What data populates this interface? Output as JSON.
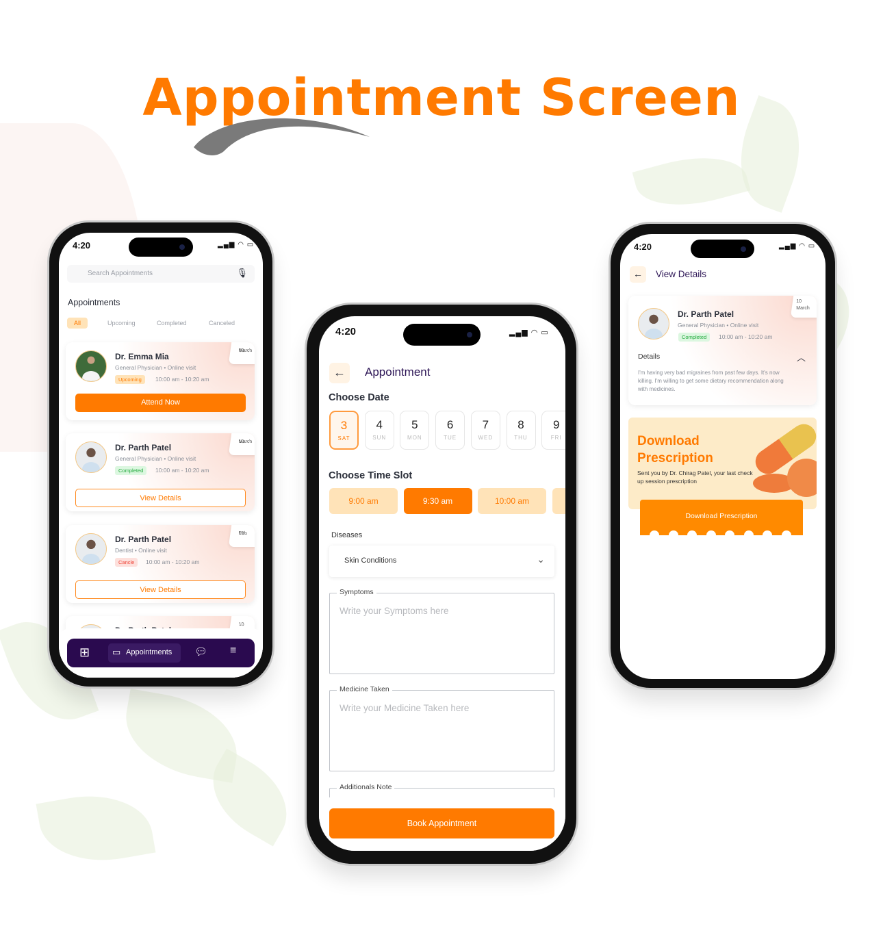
{
  "page_title": "Appointment Screen",
  "colors": {
    "accent": "#ff7a00",
    "nav_bg": "#2a0a4f",
    "title_purple": "#2d1656"
  },
  "status_time": "4:20",
  "list_screen": {
    "search_placeholder": "Search Appointments",
    "mic_icon": "microphone-icon",
    "heading": "Appointments",
    "tabs": [
      {
        "label": "All",
        "active": true
      },
      {
        "label": "Upcoming"
      },
      {
        "label": "Completed"
      },
      {
        "label": "Canceled"
      }
    ],
    "cards": [
      {
        "name": "Dr. Emma Mia",
        "specialty": "General Physician",
        "visit": "Online visit",
        "status": "Upcoming",
        "time": "10:00 am - 10:20 am",
        "day": "03",
        "month": "March",
        "button": "Attend Now",
        "primary": true
      },
      {
        "name": "Dr. Parth Patel",
        "specialty": "General Physician",
        "visit": "Online visit",
        "status": "Completed",
        "time": "10:00 am - 10:20 am",
        "day": "10",
        "month": "March",
        "button": "View Details"
      },
      {
        "name": "Dr. Parth Patel",
        "specialty": "Dentist",
        "visit": "Online visit",
        "status": "Cancle",
        "time": "10:00 am - 10:20 am",
        "day": "10",
        "month": "Feb",
        "button": "View Details"
      },
      {
        "name": "Dr. Parth Patel",
        "day": "10"
      }
    ],
    "nav": {
      "items": [
        {
          "icon": "grid-icon"
        },
        {
          "icon": "calendar-card-icon",
          "label": "Appointments",
          "active": true
        },
        {
          "icon": "chat-icon"
        },
        {
          "icon": "menu-icon"
        }
      ]
    }
  },
  "booking_screen": {
    "title": "Appointment",
    "choose_date": "Choose Date",
    "dates": [
      {
        "n": "3",
        "d": "SAT",
        "selected": true
      },
      {
        "n": "4",
        "d": "SUN"
      },
      {
        "n": "5",
        "d": "MON"
      },
      {
        "n": "6",
        "d": "TUE"
      },
      {
        "n": "7",
        "d": "WED"
      },
      {
        "n": "8",
        "d": "THU"
      },
      {
        "n": "9",
        "d": "FRI"
      }
    ],
    "choose_time": "Choose Time Slot",
    "slots": [
      {
        "t": "9:00 am"
      },
      {
        "t": "9:30 am",
        "selected": true
      },
      {
        "t": "10:00 am"
      },
      {
        "t": ""
      }
    ],
    "diseases_label": "Diseases",
    "diseases_value": "Skin Conditions",
    "symptoms_label": "Symptoms",
    "symptoms_placeholder": "Write your Symptoms here",
    "medicine_label": "Medicine Taken",
    "medicine_placeholder": "Write your Medicine Taken here",
    "notes_label": "Additionals Note",
    "book_button": "Book Appointment"
  },
  "details_screen": {
    "title": "View Details",
    "name": "Dr. Parth Patel",
    "specialty": "General Physician",
    "visit": "Online visit",
    "status": "Completed",
    "time": "10:00 am - 10:20 am",
    "day": "10",
    "month": "March",
    "details_label": "Details",
    "details_text": "I'm having very bad migraines from past few days. It's now killing. I'm willing to get some dietary recommendation along with medicines.",
    "banner_title_1": "Download",
    "banner_title_2": "Prescription",
    "banner_text": "Sent you by Dr. Chirag Patel, your last check up session prescription",
    "download_button": "Download Prescription"
  }
}
